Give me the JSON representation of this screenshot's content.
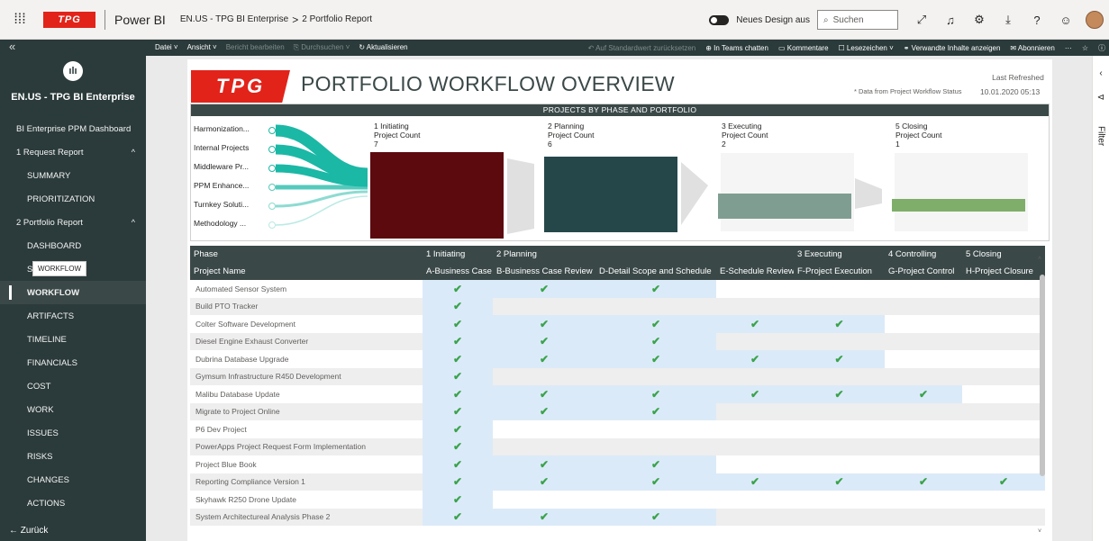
{
  "topbar": {
    "app_logo": "TPG",
    "app_name": "Power BI",
    "breadcrumb_workspace": "EN.US - TPG BI Enterprise",
    "breadcrumb_sep": ">",
    "breadcrumb_report": "2 Portfolio Report",
    "design_toggle_label": "Neues Design aus",
    "search_placeholder": "Suchen",
    "icons": [
      "expand-icon",
      "bell-icon",
      "gear-icon",
      "download-icon",
      "help-icon",
      "smiley-icon",
      "user-avatar"
    ]
  },
  "leftnav": {
    "collapse_glyph": "«",
    "workspace_icon": "ılı",
    "workspace_name": "EN.US - TPG BI Enterprise",
    "items": [
      {
        "label": "BI Enterprise PPM Dashboard",
        "level": "top"
      },
      {
        "label": "1 Request Report",
        "level": "top",
        "caret": "^"
      },
      {
        "label": "SUMMARY",
        "level": "sub"
      },
      {
        "label": "PRIORITIZATION",
        "level": "sub"
      },
      {
        "label": "2 Portfolio Report",
        "level": "top",
        "caret": "^"
      },
      {
        "label": "DASHBOARD",
        "level": "sub"
      },
      {
        "label": "ST",
        "level": "sub"
      },
      {
        "label": "WORKFLOW",
        "level": "sub",
        "active": true
      },
      {
        "label": "ARTIFACTS",
        "level": "sub"
      },
      {
        "label": "TIMELINE",
        "level": "sub"
      },
      {
        "label": "FINANCIALS",
        "level": "sub"
      },
      {
        "label": "COST",
        "level": "sub"
      },
      {
        "label": "WORK",
        "level": "sub"
      },
      {
        "label": "ISSUES",
        "level": "sub"
      },
      {
        "label": "RISKS",
        "level": "sub"
      },
      {
        "label": "CHANGES",
        "level": "sub"
      },
      {
        "label": "ACTIONS",
        "level": "sub"
      }
    ],
    "tooltip": "WORKFLOW",
    "back_label": "← Zurück"
  },
  "actionbar": {
    "left": [
      {
        "label": "Datei ˅",
        "dim": false
      },
      {
        "label": "Ansicht ˅",
        "dim": false
      },
      {
        "label": "Bericht bearbeiten",
        "dim": true
      },
      {
        "label": "⎘ Durchsuchen ˅",
        "dim": true
      },
      {
        "label": "↻ Aktualisieren",
        "dim": false
      }
    ],
    "right": [
      {
        "label": "↶ Auf Standardwert zurücksetzen",
        "dim": true
      },
      {
        "label": "⊕ In Teams chatten",
        "dim": false
      },
      {
        "label": "▭ Kommentare",
        "dim": false
      },
      {
        "label": "☐ Lesezeichen ˅",
        "dim": false
      },
      {
        "label": "⚭ Verwandte Inhalte anzeigen",
        "dim": false
      },
      {
        "label": "✉ Abonnieren",
        "dim": false
      },
      {
        "label": "···",
        "dim": false
      },
      {
        "label": "☆",
        "dim": false
      },
      {
        "label": "ⓘ",
        "dim": false
      }
    ]
  },
  "report": {
    "logo": "TPG",
    "title": "PORTFOLIO WORKFLOW OVERVIEW",
    "data_note": "* Data from Project Workflow Status",
    "refreshed_label": "Last Refreshed",
    "refreshed_value": "10.01.2020 05:13"
  },
  "funnel": {
    "title": "PROJECTS BY PHASE AND PORTFOLIO",
    "categories": [
      "Harmonization...",
      "Internal Projects",
      "Middleware Pr...",
      "PPM Enhance...",
      "Turnkey Soluti...",
      "Methodology ..."
    ],
    "phases": [
      {
        "name": "1 Initiating",
        "measure": "Project Count",
        "value": "7",
        "color": "#5c0a0e"
      },
      {
        "name": "2 Planning",
        "measure": "Project Count",
        "value": "6",
        "color": "#26474a"
      },
      {
        "name": "3 Executing",
        "measure": "Project Count",
        "value": "2",
        "color": "#7f9e91"
      },
      {
        "name": "5 Closing",
        "measure": "Project Count",
        "value": "1",
        "color": "#7fae6a"
      }
    ]
  },
  "table": {
    "phase_label": "Phase",
    "project_label": "Project Name",
    "phase_groups": [
      {
        "label": "1 Initiating",
        "cols": 1
      },
      {
        "label": "2 Planning",
        "cols": 3
      },
      {
        "label": "3 Executing",
        "cols": 1
      },
      {
        "label": "4 Controlling",
        "cols": 1
      },
      {
        "label": "5 Closing",
        "cols": 1
      }
    ],
    "columns": [
      "A-Business Case",
      "B-Business Case Review",
      "D-Detail Scope and Schedule",
      "E-Schedule Review",
      "F-Project Execution",
      "G-Project Control",
      "H-Project Closure"
    ],
    "check_glyph": "✔",
    "rows": [
      {
        "name": "Automated Sensor System",
        "checks": [
          1,
          1,
          1,
          0,
          0,
          0,
          0
        ],
        "hl": 3
      },
      {
        "name": "Build PTO Tracker",
        "checks": [
          1,
          0,
          0,
          0,
          0,
          0,
          0
        ],
        "hl": 1
      },
      {
        "name": "Colter Software Development",
        "checks": [
          1,
          1,
          1,
          1,
          1,
          0,
          0
        ],
        "hl": 5
      },
      {
        "name": "Diesel Engine Exhaust Converter",
        "checks": [
          1,
          1,
          1,
          0,
          0,
          0,
          0
        ],
        "hl": 3
      },
      {
        "name": "Dubrina Database Upgrade",
        "checks": [
          1,
          1,
          1,
          1,
          1,
          0,
          0
        ],
        "hl": 5
      },
      {
        "name": "Gymsum Infrastructure R450 Development",
        "checks": [
          1,
          0,
          0,
          0,
          0,
          0,
          0
        ],
        "hl": 1
      },
      {
        "name": "Malibu Database Update",
        "checks": [
          1,
          1,
          1,
          1,
          1,
          1,
          0
        ],
        "hl": 6
      },
      {
        "name": "Migrate to Project Online",
        "checks": [
          1,
          1,
          1,
          0,
          0,
          0,
          0
        ],
        "hl": 3
      },
      {
        "name": "P6 Dev Project",
        "checks": [
          1,
          0,
          0,
          0,
          0,
          0,
          0
        ],
        "hl": 1
      },
      {
        "name": "PowerApps Project Request Form Implementation",
        "checks": [
          1,
          0,
          0,
          0,
          0,
          0,
          0
        ],
        "hl": 1
      },
      {
        "name": "Project Blue Book",
        "checks": [
          1,
          1,
          1,
          0,
          0,
          0,
          0
        ],
        "hl": 3
      },
      {
        "name": "Reporting Compliance Version 1",
        "checks": [
          1,
          1,
          1,
          1,
          1,
          1,
          1
        ],
        "hl": 7
      },
      {
        "name": "Skyhawk R250 Drone Update",
        "checks": [
          1,
          0,
          0,
          0,
          0,
          0,
          0
        ],
        "hl": 1
      },
      {
        "name": "System Architectureal Analysis Phase 2",
        "checks": [
          1,
          1,
          1,
          0,
          0,
          0,
          0
        ],
        "hl": 3
      }
    ]
  },
  "rightpane": {
    "collapse_glyph": "‹",
    "filter_icon": "⊲",
    "filter_label": "Filter"
  }
}
